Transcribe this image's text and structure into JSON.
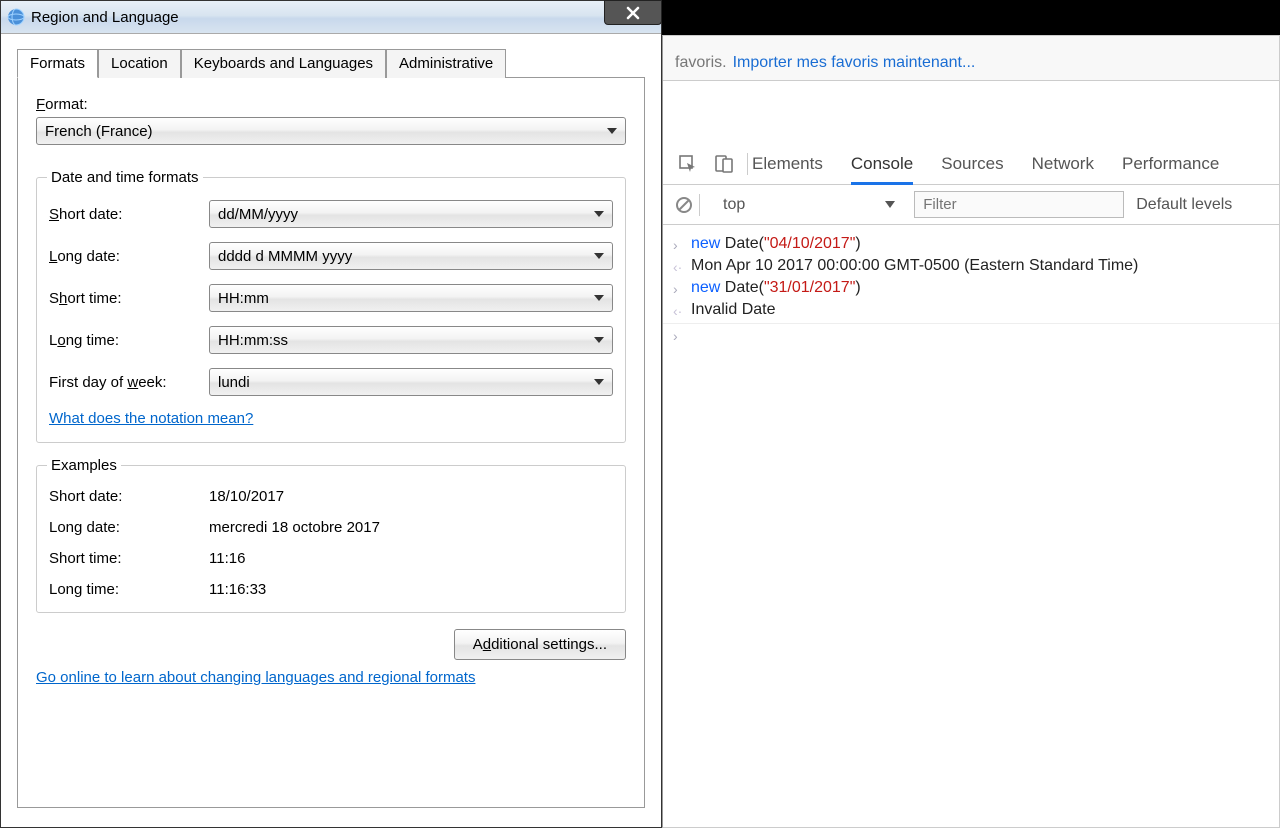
{
  "window": {
    "title": "Region and Language",
    "tabs": [
      "Formats",
      "Location",
      "Keyboards and Languages",
      "Administrative"
    ],
    "format_label": "Format:",
    "format_value": "French (France)",
    "fieldset_title": "Date and time formats",
    "rows": {
      "short_date_label": "Short date:",
      "short_date_value": "dd/MM/yyyy",
      "long_date_label": "Long date:",
      "long_date_value": "dddd d MMMM yyyy",
      "short_time_label": "Short time:",
      "short_time_value": "HH:mm",
      "long_time_label": "Long time:",
      "long_time_value": "HH:mm:ss",
      "first_day_label": "First day of week:",
      "first_day_value": "lundi"
    },
    "notation_link": "What does the notation mean?",
    "examples_title": "Examples",
    "examples": {
      "short_date_l": "Short date:",
      "short_date_v": "18/10/2017",
      "long_date_l": "Long date:",
      "long_date_v": "mercredi 18 octobre 2017",
      "short_time_l": "Short time:",
      "short_time_v": "11:16",
      "long_time_l": "Long time:",
      "long_time_v": "11:16:33"
    },
    "additional_btn": "Additional settings...",
    "online_link": "Go online to learn about changing languages and regional formats"
  },
  "browser": {
    "bookmark_text": "favoris.",
    "bookmark_link": "Importer mes favoris maintenant...",
    "devtools_tabs": [
      "Elements",
      "Console",
      "Sources",
      "Network",
      "Performance"
    ],
    "context": "top",
    "filter_placeholder": "Filter",
    "levels": "Default levels",
    "console": {
      "l1a": "new",
      "l1b": " Date(",
      "l1c": "\"04/10/2017\"",
      "l1d": ")",
      "l2": "Mon Apr 10 2017 00:00:00 GMT-0500 (Eastern Standard Time)",
      "l3a": "new",
      "l3b": " Date(",
      "l3c": "\"31/01/2017\"",
      "l3d": ")",
      "l4": "Invalid Date"
    }
  }
}
